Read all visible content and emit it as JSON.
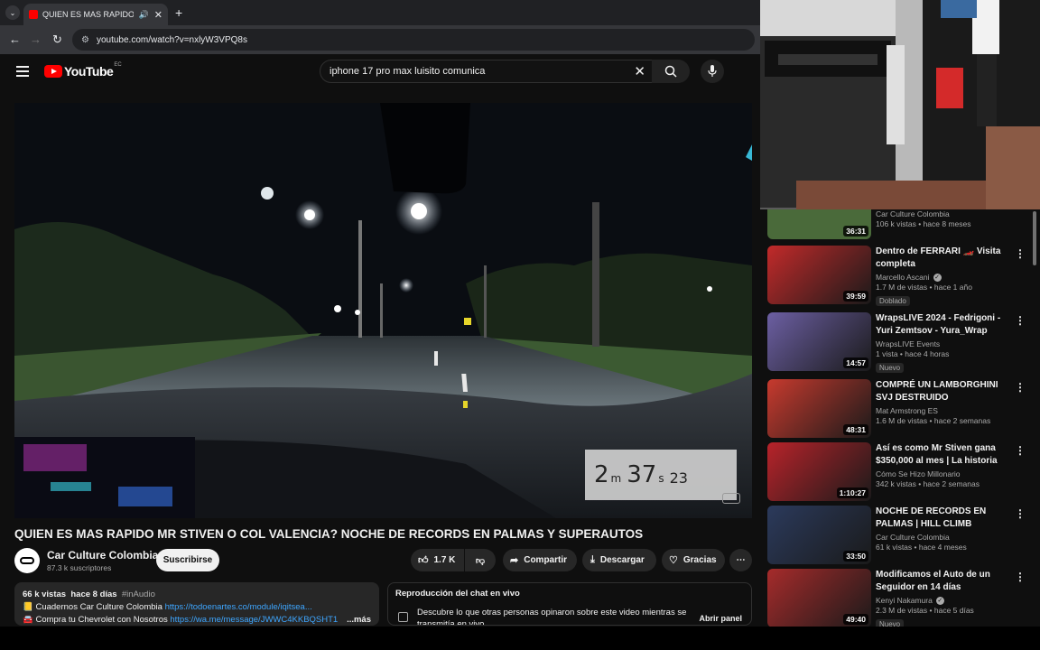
{
  "browser": {
    "tab_title": "QUIEN ES MAS RAPIDO MR STIVEN",
    "url": "youtube.com/watch?v=nxlyW3VPQ8s"
  },
  "header": {
    "logo": "YouTube",
    "region": "EC",
    "search_value": "iphone 17 pro max luisito comunica"
  },
  "player": {
    "timer_minutes": "2",
    "timer_m": "m",
    "timer_seconds": "37",
    "timer_s": "s",
    "timer_frames": "23"
  },
  "video": {
    "title": "QUIEN ES MAS RAPIDO MR STIVEN O COL VALENCIA? NOCHE DE RECORDS EN PALMAS Y SUPERAUTOS",
    "channel": "Car Culture Colombia",
    "subscribers": "87.3 k suscriptores",
    "subscribe_label": "Suscribirse",
    "likes": "1.7 K",
    "share_label": "Compartir",
    "download_label": "Descargar",
    "thanks_label": "Gracias"
  },
  "description": {
    "views": "66 k vistas",
    "date": "hace 8 días",
    "hashtag": "#inAudio",
    "line1_text": "📒 Cuadernos Car Culture Colombia ",
    "line1_link": "https://todoenartes.co/module/iqitsea...",
    "line2_text": "🚘 Compra tu Chevrolet con Nosotros ",
    "line2_link": "https://wa.me/message/JWWC4KKBQSHT1",
    "more": "...más"
  },
  "chat": {
    "heading": "Reproducción del chat en vivo",
    "text": "Descubre lo que otras personas opinaron sobre este video mientras se transmitía en vivo.",
    "open_label": "Abrir panel"
  },
  "sidebar": {
    "partial": {
      "channel": "Car Culture Colombia",
      "stats": "106 k vistas • hace 8 meses",
      "duration": "36:31"
    },
    "items": [
      {
        "title": "Dentro de FERRARI 🏎️ Visita completa",
        "channel": "Marcello Ascani",
        "verified": true,
        "stats": "1.7 M de vistas • hace 1 año",
        "badge": "Doblado",
        "duration": "39:59",
        "thumb_color": "#c22a2a"
      },
      {
        "title": "WrapsLIVE 2024 - Fedrigoni - Yuri Zemtsov - Yura_Wrap",
        "channel": "WrapsLIVE Events",
        "verified": false,
        "stats": "1 vista • hace 4 horas",
        "badge": "Nuevo",
        "duration": "14:57",
        "thumb_color": "#6c5fa3"
      },
      {
        "title": "COMPRÉ UN LAMBORGHINI SVJ DESTRUIDO",
        "channel": "Mat Armstrong ES",
        "verified": false,
        "stats": "1.6 M de vistas • hace 2 semanas",
        "badge": "",
        "duration": "48:31",
        "thumb_color": "#c73a2e"
      },
      {
        "title": "Así es como Mr Stiven gana $350,000 al mes | La historia d...",
        "channel": "Cómo Se Hizo Millonario",
        "verified": false,
        "stats": "342 k vistas • hace 2 semanas",
        "badge": "",
        "duration": "1:10:27",
        "thumb_color": "#b8232a"
      },
      {
        "title": "NOCHE DE RECORDS EN PALMAS | HILL CLIMB ABORD...",
        "channel": "Car Culture Colombia",
        "verified": false,
        "stats": "61 k vistas • hace 4 meses",
        "badge": "",
        "duration": "33:50",
        "thumb_color": "#2b3a5c"
      },
      {
        "title": "Modificamos el Auto de un Seguidor en 14 días",
        "channel": "Kenyi Nakamura",
        "verified": true,
        "stats": "2.3 M de vistas • hace 5 días",
        "badge": "Nuevo",
        "duration": "49:40",
        "thumb_color": "#a62b2b"
      }
    ]
  }
}
